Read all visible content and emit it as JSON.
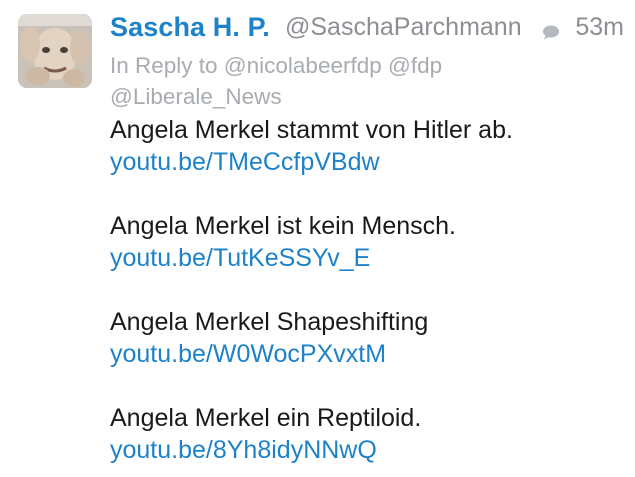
{
  "tweet": {
    "display_name": "Sascha H. P.",
    "handle": "@SaschaParchmann",
    "timestamp": "53m",
    "reply_to": "In Reply to @nicolabeerfdp @fdp @Liberale_News",
    "paragraphs": [
      {
        "text": "Angela Merkel stammt von Hitler ab.",
        "link": "youtu.be/TMeCcfpVBdw"
      },
      {
        "text": "Angela Merkel ist kein Mensch.",
        "link": "youtu.be/TutKeSSYv_E"
      },
      {
        "text": "Angela Merkel Shapeshifting",
        "link": "youtu.be/W0WocPXvxtM"
      },
      {
        "text": "Angela Merkel ein Reptiloid.",
        "link": "youtu.be/8Yh8idyNNwQ"
      }
    ]
  },
  "colors": {
    "accent": "#1e82c8",
    "muted": "#8b8f94",
    "text": "#1a1a1a"
  },
  "icons": {
    "avatar": "avatar-photo",
    "conversation": "speech-bubble-icon"
  }
}
